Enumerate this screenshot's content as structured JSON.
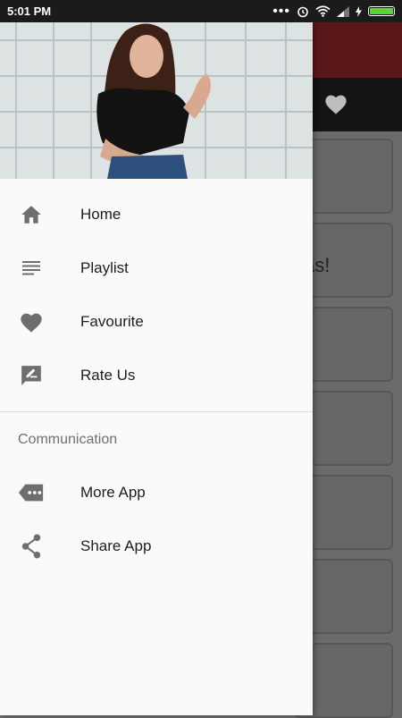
{
  "status_bar": {
    "time": "5:01 PM",
    "icons": [
      "more-dots-icon",
      "alarm-icon",
      "wifi-icon",
      "signal-icon",
      "charging-icon",
      "battery-icon"
    ],
    "battery_color": "#5bd43b"
  },
  "background_app": {
    "topbar_color": "#5a1718",
    "visible_text": "as!"
  },
  "drawer": {
    "header_image": "woman-portrait-photo",
    "items": [
      {
        "label": "Home",
        "icon": "home-icon"
      },
      {
        "label": "Playlist",
        "icon": "list-icon"
      },
      {
        "label": "Favourite",
        "icon": "heart-icon"
      },
      {
        "label": "Rate Us",
        "icon": "rate-icon"
      }
    ],
    "section_title": "Communication",
    "section_items": [
      {
        "label": "More App",
        "icon": "more-app-icon"
      },
      {
        "label": "Share App",
        "icon": "share-icon"
      }
    ],
    "icon_color": "#6e6e6e"
  }
}
